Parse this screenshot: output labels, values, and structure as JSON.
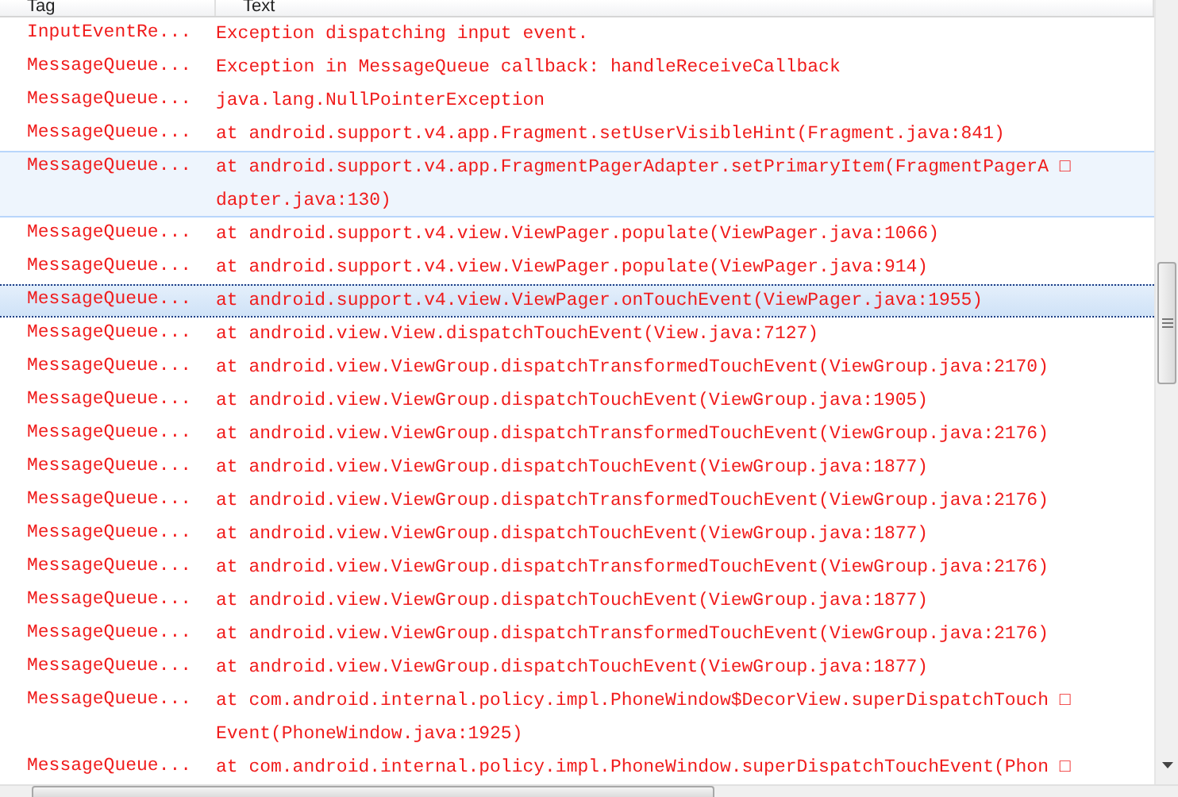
{
  "table": {
    "columns": [
      "Tag",
      "Text"
    ],
    "rows": [
      {
        "tag": "InputEventRe...",
        "lines": [
          "Exception dispatching input event."
        ],
        "selected": false,
        "hovered": false
      },
      {
        "tag": "MessageQueue...",
        "lines": [
          "Exception in MessageQueue callback: handleReceiveCallback"
        ],
        "selected": false,
        "hovered": false
      },
      {
        "tag": "MessageQueue...",
        "lines": [
          "java.lang.NullPointerException"
        ],
        "selected": false,
        "hovered": false
      },
      {
        "tag": "MessageQueue...",
        "lines": [
          "at android.support.v4.app.Fragment.setUserVisibleHint(Fragment.java:841)"
        ],
        "selected": false,
        "hovered": false
      },
      {
        "tag": "MessageQueue...",
        "lines": [
          "at android.support.v4.app.FragmentPagerAdapter.setPrimaryItem(FragmentPagerA □",
          "dapter.java:130)"
        ],
        "selected": false,
        "hovered": true
      },
      {
        "tag": "MessageQueue...",
        "lines": [
          "at android.support.v4.view.ViewPager.populate(ViewPager.java:1066)"
        ],
        "selected": false,
        "hovered": false
      },
      {
        "tag": "MessageQueue...",
        "lines": [
          "at android.support.v4.view.ViewPager.populate(ViewPager.java:914)"
        ],
        "selected": false,
        "hovered": false
      },
      {
        "tag": "MessageQueue...",
        "lines": [
          "at android.support.v4.view.ViewPager.onTouchEvent(ViewPager.java:1955)"
        ],
        "selected": true,
        "hovered": false
      },
      {
        "tag": "MessageQueue...",
        "lines": [
          "at android.view.View.dispatchTouchEvent(View.java:7127)"
        ],
        "selected": false,
        "hovered": false
      },
      {
        "tag": "MessageQueue...",
        "lines": [
          "at android.view.ViewGroup.dispatchTransformedTouchEvent(ViewGroup.java:2170)"
        ],
        "selected": false,
        "hovered": false
      },
      {
        "tag": "MessageQueue...",
        "lines": [
          "at android.view.ViewGroup.dispatchTouchEvent(ViewGroup.java:1905)"
        ],
        "selected": false,
        "hovered": false
      },
      {
        "tag": "MessageQueue...",
        "lines": [
          "at android.view.ViewGroup.dispatchTransformedTouchEvent(ViewGroup.java:2176)"
        ],
        "selected": false,
        "hovered": false
      },
      {
        "tag": "MessageQueue...",
        "lines": [
          "at android.view.ViewGroup.dispatchTouchEvent(ViewGroup.java:1877)"
        ],
        "selected": false,
        "hovered": false
      },
      {
        "tag": "MessageQueue...",
        "lines": [
          "at android.view.ViewGroup.dispatchTransformedTouchEvent(ViewGroup.java:2176)"
        ],
        "selected": false,
        "hovered": false
      },
      {
        "tag": "MessageQueue...",
        "lines": [
          "at android.view.ViewGroup.dispatchTouchEvent(ViewGroup.java:1877)"
        ],
        "selected": false,
        "hovered": false
      },
      {
        "tag": "MessageQueue...",
        "lines": [
          "at android.view.ViewGroup.dispatchTransformedTouchEvent(ViewGroup.java:2176)"
        ],
        "selected": false,
        "hovered": false
      },
      {
        "tag": "MessageQueue...",
        "lines": [
          "at android.view.ViewGroup.dispatchTouchEvent(ViewGroup.java:1877)"
        ],
        "selected": false,
        "hovered": false
      },
      {
        "tag": "MessageQueue...",
        "lines": [
          "at android.view.ViewGroup.dispatchTransformedTouchEvent(ViewGroup.java:2176)"
        ],
        "selected": false,
        "hovered": false
      },
      {
        "tag": "MessageQueue...",
        "lines": [
          "at android.view.ViewGroup.dispatchTouchEvent(ViewGroup.java:1877)"
        ],
        "selected": false,
        "hovered": false
      },
      {
        "tag": "MessageQueue...",
        "lines": [
          "at com.android.internal.policy.impl.PhoneWindow$DecorView.superDispatchTouch □",
          "Event(PhoneWindow.java:1925)"
        ],
        "selected": false,
        "hovered": false
      },
      {
        "tag": "MessageQueue...",
        "lines": [
          "at com.android.internal.policy.impl.PhoneWindow.superDispatchTouchEvent(Phon □"
        ],
        "selected": false,
        "hovered": false
      }
    ]
  }
}
